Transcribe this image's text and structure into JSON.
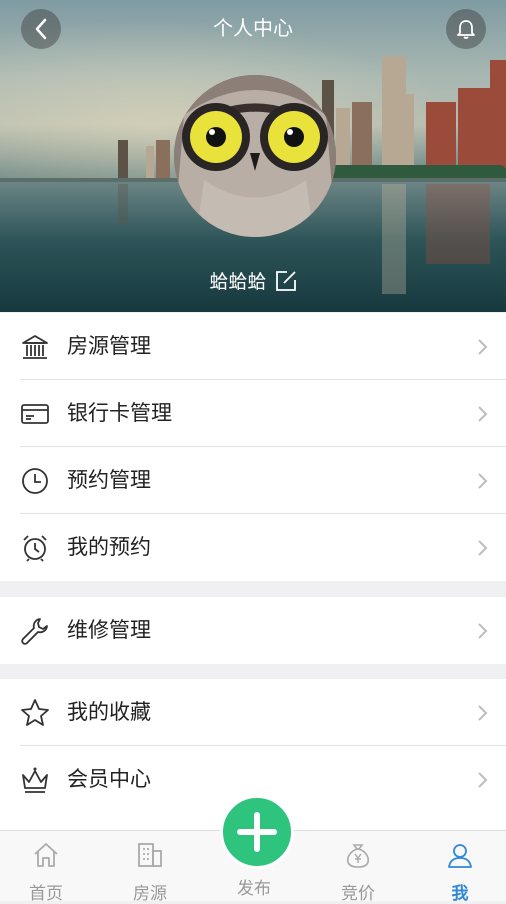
{
  "header": {
    "title": "个人中心",
    "username": "蛤蛤蛤"
  },
  "menu_groups": [
    {
      "items": [
        {
          "label": "房源管理",
          "icon": "building-icon"
        },
        {
          "label": "银行卡管理",
          "icon": "bank-card-icon"
        },
        {
          "label": "预约管理",
          "icon": "clock-icon"
        },
        {
          "label": "我的预约",
          "icon": "alarm-clock-icon"
        }
      ]
    },
    {
      "items": [
        {
          "label": "维修管理",
          "icon": "wrench-icon"
        }
      ]
    },
    {
      "items": [
        {
          "label": "我的收藏",
          "icon": "star-icon"
        },
        {
          "label": "会员中心",
          "icon": "crown-icon"
        }
      ]
    }
  ],
  "tabbar": {
    "items": [
      {
        "label": "首页",
        "icon": "home-icon"
      },
      {
        "label": "房源",
        "icon": "buildings-icon"
      },
      {
        "label": "发布",
        "icon": "plus-icon"
      },
      {
        "label": "竞价",
        "icon": "money-bag-icon"
      },
      {
        "label": "我",
        "icon": "user-icon"
      }
    ],
    "active": "我"
  },
  "colors": {
    "active_tab": "#2f87d8",
    "publish_button": "#2ec47e",
    "separator": "#f0f0f2"
  }
}
